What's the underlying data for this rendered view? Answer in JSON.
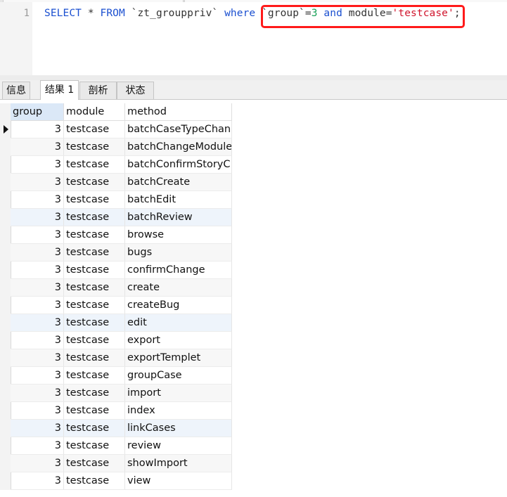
{
  "editor": {
    "line_number": "1",
    "tokens": [
      {
        "text": "SELECT",
        "kind": "kw"
      },
      {
        "text": " * ",
        "kind": "ident"
      },
      {
        "text": "FROM",
        "kind": "kw"
      },
      {
        "text": " `zt_grouppriv` ",
        "kind": "ident"
      },
      {
        "text": "where",
        "kind": "kw"
      },
      {
        "text": " `group`=",
        "kind": "ident"
      },
      {
        "text": "3",
        "kind": "num"
      },
      {
        "text": " ",
        "kind": "ident"
      },
      {
        "text": "and",
        "kind": "kw"
      },
      {
        "text": " module=",
        "kind": "ident"
      },
      {
        "text": "'testcase'",
        "kind": "str"
      },
      {
        "text": ";",
        "kind": "ident"
      }
    ]
  },
  "tabs": [
    {
      "label": "信息",
      "active": false
    },
    {
      "label": "结果 1",
      "active": true
    },
    {
      "label": "剖析",
      "active": false
    },
    {
      "label": "状态",
      "active": false
    }
  ],
  "table": {
    "columns": [
      "group",
      "module",
      "method"
    ],
    "rows": [
      [
        "3",
        "testcase",
        "batchCaseTypeChan"
      ],
      [
        "3",
        "testcase",
        "batchChangeModule"
      ],
      [
        "3",
        "testcase",
        "batchConfirmStoryC"
      ],
      [
        "3",
        "testcase",
        "batchCreate"
      ],
      [
        "3",
        "testcase",
        "batchEdit"
      ],
      [
        "3",
        "testcase",
        "batchReview"
      ],
      [
        "3",
        "testcase",
        "browse"
      ],
      [
        "3",
        "testcase",
        "bugs"
      ],
      [
        "3",
        "testcase",
        "confirmChange"
      ],
      [
        "3",
        "testcase",
        "create"
      ],
      [
        "3",
        "testcase",
        "createBug"
      ],
      [
        "3",
        "testcase",
        "edit"
      ],
      [
        "3",
        "testcase",
        "export"
      ],
      [
        "3",
        "testcase",
        "exportTemplet"
      ],
      [
        "3",
        "testcase",
        "groupCase"
      ],
      [
        "3",
        "testcase",
        "import"
      ],
      [
        "3",
        "testcase",
        "index"
      ],
      [
        "3",
        "testcase",
        "linkCases"
      ],
      [
        "3",
        "testcase",
        "review"
      ],
      [
        "3",
        "testcase",
        "showImport"
      ],
      [
        "3",
        "testcase",
        "view"
      ]
    ],
    "highlighted_rows": [
      5,
      11,
      17
    ]
  },
  "colors": {
    "keyword": "#1a4fd0",
    "number": "#1aa35a",
    "string": "#d0142c",
    "annotation_box": "#ff1a1a"
  }
}
